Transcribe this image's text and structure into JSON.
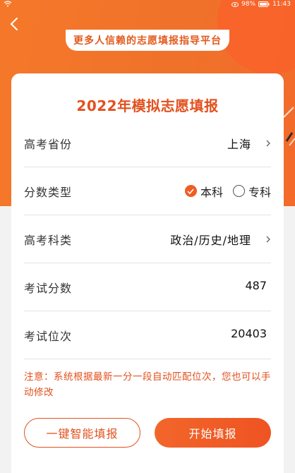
{
  "status_bar": {
    "battery": "98%",
    "time": "11:43"
  },
  "header": {
    "back_icon": "chevron-left-icon",
    "slogan": "更多人信赖的志愿填报指导平台"
  },
  "card": {
    "title": "2022年模拟志愿填报",
    "rows": {
      "province": {
        "label": "高考省份",
        "value": "上海"
      },
      "score_type": {
        "label": "分数类型",
        "options": [
          {
            "label": "本科",
            "selected": true
          },
          {
            "label": "专科",
            "selected": false
          }
        ]
      },
      "subjects": {
        "label": "高考科类",
        "value": "政治/历史/地理"
      },
      "score": {
        "label": "考试分数",
        "value": "487"
      },
      "rank": {
        "label": "考试位次",
        "value": "20403"
      }
    },
    "note": "注意：系统根据最新一分一段自动匹配位次，您也可以手动修改"
  },
  "actions": {
    "smart_fill": "一键智能填报",
    "start_fill": "开始填报"
  },
  "colors": {
    "accent": "#ef5d24",
    "hero": "#f5782a"
  }
}
